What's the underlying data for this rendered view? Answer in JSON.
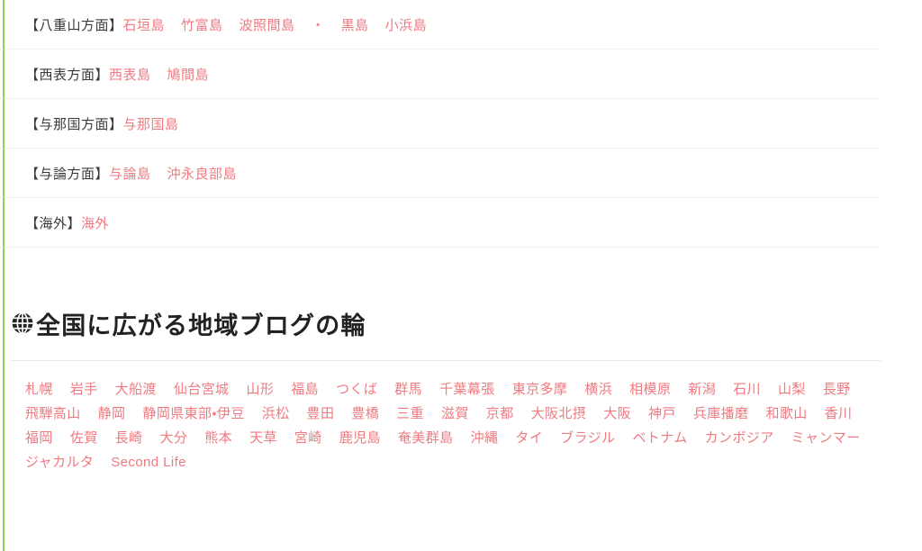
{
  "theme": {
    "link_color": "#ef7a80",
    "text_color": "#3a3a3a",
    "accent_rail_color": "#8fce5a",
    "divider_color": "#e2e2e2"
  },
  "area_list": {
    "rows": [
      {
        "label": "【八重山方面】",
        "links": [
          "石垣島",
          "竹富島",
          "波照間島",
          "黒島",
          "小浜島"
        ],
        "separator_after_index": 2,
        "separator": "・"
      },
      {
        "label": "【西表方面】",
        "links": [
          "西表島",
          "鳩間島"
        ],
        "separator_after_index": -1,
        "separator": ""
      },
      {
        "label": "【与那国方面】",
        "links": [
          "与那国島"
        ],
        "separator_after_index": -1,
        "separator": ""
      },
      {
        "label": "【与論方面】",
        "links": [
          "与論島",
          "沖永良部島"
        ],
        "separator_after_index": -1,
        "separator": ""
      },
      {
        "label": "【海外】",
        "links": [
          "海外"
        ],
        "separator_after_index": -1,
        "separator": ""
      }
    ]
  },
  "blog_ring": {
    "icon": "globe-icon",
    "heading": "全国に広がる地域ブログの輪",
    "tags": [
      "札幌",
      "岩手",
      "大船渡",
      "仙台宮城",
      "山形",
      "福島",
      "つくば",
      "群馬",
      "千葉幕張",
      "東京多摩",
      "横浜",
      "相模原",
      "新潟",
      "石川",
      "山梨",
      "長野",
      "飛騨高山",
      "静岡",
      "静岡県東部・伊豆",
      "浜松",
      "豊田",
      "豊橋",
      "三重",
      "滋賀",
      "京都",
      "大阪北摂",
      "大阪",
      "神戸",
      "兵庫播磨",
      "和歌山",
      "香川",
      "福岡",
      "佐賀",
      "長崎",
      "大分",
      "熊本",
      "天草",
      "宮崎",
      "鹿児島",
      "奄美群島",
      "沖縄",
      "タイ",
      "ブラジル",
      "ベトナム",
      "カンボジア",
      "ミャンマー",
      "ジャカルタ",
      "Second Life"
    ]
  }
}
